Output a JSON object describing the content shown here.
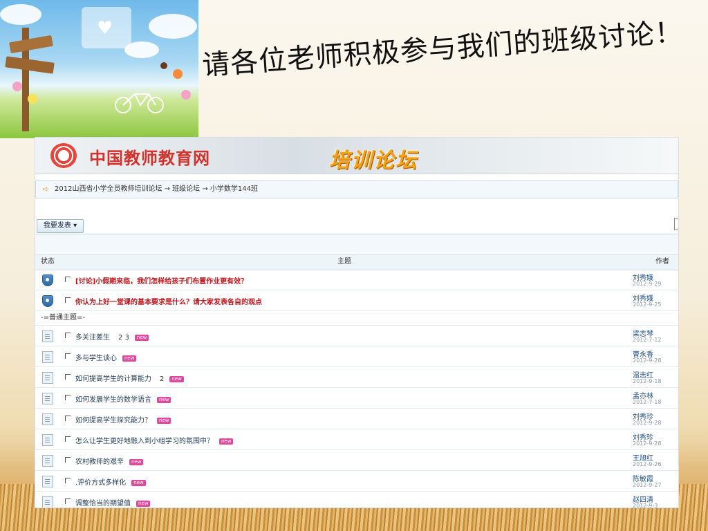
{
  "slide": {
    "title": "请各位老师积极参与我们的班级讨论！"
  },
  "banner": {
    "site_name": "中国教师教育网",
    "forum_name": "培训论坛"
  },
  "breadcrumb": {
    "text": "2012山西省小学全员教师培训论坛 → 班级论坛 → 小学数学144班"
  },
  "toolbar": {
    "post_button_label": "我要发表 ▾"
  },
  "table": {
    "headers": {
      "status": "状态",
      "subject": "主题",
      "author": "作者"
    },
    "section_label": "-=普通主题=-",
    "sticky_rows": [
      {
        "subject": "[讨论]小假期来临，我们怎样给孩子们布置作业更有效？",
        "author": "刘秀娥",
        "date": "2012-9-29"
      },
      {
        "subject": "你认为上好一堂课的基本要求是什么？请大家发表各自的观点",
        "author": "刘秀娥",
        "date": "2012-9-25"
      }
    ],
    "rows": [
      {
        "subject": "多关注差生",
        "pages": "2 3",
        "new": "new",
        "author": "梁志琴",
        "date": "2012-7-12"
      },
      {
        "subject": "多与学生谈心",
        "pages": "",
        "new": "new",
        "author": "曹永香",
        "date": "2012-9-28"
      },
      {
        "subject": "如何提高学生的计算能力",
        "pages": "2",
        "new": "new",
        "author": "温志红",
        "date": "2012-9-18"
      },
      {
        "subject": "如何发展学生的数学语言",
        "pages": "",
        "new": "new",
        "author": "孟亦林",
        "date": "2012-7-18"
      },
      {
        "subject": "如何提高学生探究能力？",
        "pages": "",
        "new": "new",
        "author": "刘秀珍",
        "date": "2012-9-28"
      },
      {
        "subject": "怎么让学生更好地融入到小组学习的氛围中？",
        "pages": "",
        "new": "new",
        "author": "刘秀珍",
        "date": "2012-9-28"
      },
      {
        "subject": "农村教师的艰辛",
        "pages": "",
        "new": "new",
        "author": "王旭红",
        "date": "2012-9-26"
      },
      {
        "subject": ".评价方式多样化",
        "pages": "",
        "new": "new",
        "author": "陈敏霞",
        "date": "2012-9-27"
      },
      {
        "subject": "调整恰当的期望值",
        "pages": "",
        "new": "new",
        "author": "赵四清",
        "date": "2012-9-3"
      }
    ]
  }
}
